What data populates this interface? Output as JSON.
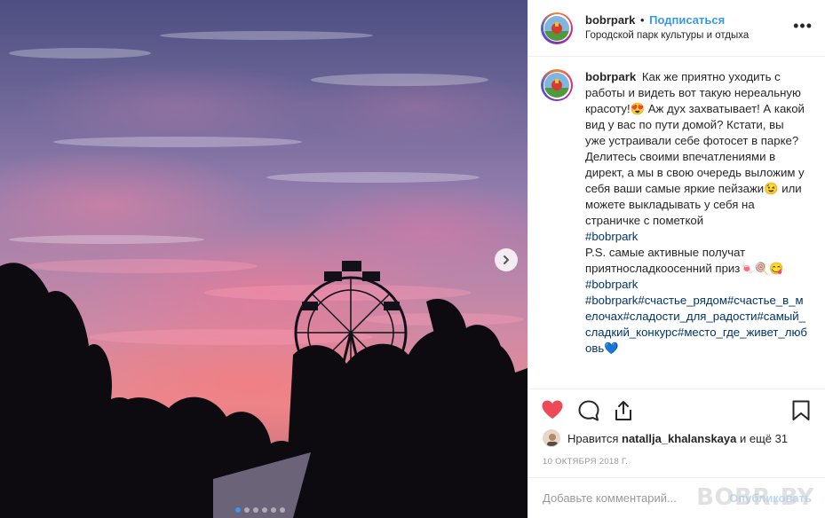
{
  "post": {
    "username": "bobrpark",
    "separator": "•",
    "follow_label": "Подписаться",
    "location": "Городской парк культуры и отдыха",
    "more_label": "•••",
    "caption": {
      "text_1": "Как же приятно уходить с работы и видеть вот такую нереальную красоту!😍 Аж дух захватывает! А какой вид у вас по пути домой? Кстати, вы уже устраивали себе фотосет в парке? Делитесь своими впечатлениями в директ, а мы в свою очередь выложим у себя ваши самые яркие пейзажи😉 или можете выкладывать у себя на страничке с пометкой",
      "hashtag_1": "#bobrpark",
      "text_2": "P.S. самые активные получат приятносладкоосенний приз🍬🍭😋",
      "hashtag_2": "#bobrpark",
      "hashtags_3": "#bobrpark#счастье_рядом#счастье_в_мелочах#сладости_для_радости#самый_сладкий_конкурс#место_где_живет_любовь",
      "heart_emoji": "💙"
    },
    "likes": {
      "prefix": "Нравится",
      "user": "natallja_khalanskaya",
      "suffix": "и ещё 31"
    },
    "date": "10 ОКТЯБРЯ 2018 Г.",
    "comment": {
      "placeholder": "Добавьте комментарий...",
      "publish_label": "Опубликовать"
    },
    "watermark": "BOBR.BY"
  },
  "carousel": {
    "total": 6,
    "active_index": 0
  },
  "icons": {
    "like": "heart-icon",
    "comment": "comment-icon",
    "share": "share-icon",
    "save": "bookmark-icon",
    "next": "chevron-right-icon"
  },
  "colors": {
    "like_red": "#ed4956",
    "link_blue": "#3897f0",
    "hashtag_blue": "#003569"
  }
}
